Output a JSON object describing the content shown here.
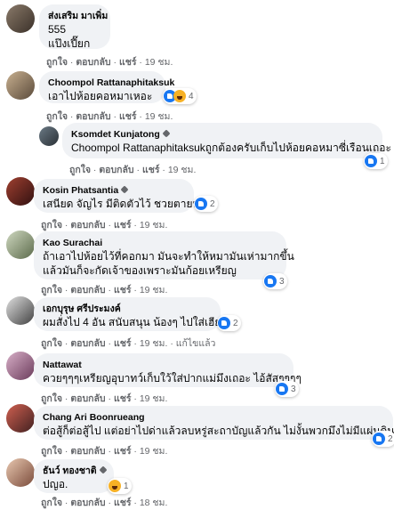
{
  "actions": {
    "like": "ถูกใจ",
    "reply": "ตอบกลับ",
    "share": "แชร์",
    "sep": "·",
    "edited": "แก้ไขแล้ว"
  },
  "comments": [
    {
      "author": "ส่งเสริม มาเพิ่ม",
      "lines": [
        "555",
        "แป๊งเปี๊ยก"
      ],
      "time": "19 ชม."
    },
    {
      "author": "Choompol Rattanaphitaksuk",
      "lines": [
        "เอาไปห้อยคอหมาเหอะ"
      ],
      "reaction": "4",
      "time": "19 ชม."
    },
    {
      "author": "Ksomdet Kunjatong",
      "lines": [
        "Choompol Rattanaphitaksukถูกต้องครับเก็บไปห้อยคอหมาซี่เรือนเถอะ"
      ],
      "reaction": "1",
      "time": "19 ชม."
    },
    {
      "author": "Kosin Phatsantia",
      "lines": [
        "เสนียด จัญไร มีติดตัวไว้ ชวยตายห่า"
      ],
      "reaction": "2",
      "time": "19 ชม."
    },
    {
      "author": "Kao Surachai",
      "lines": [
        "ถ้าเอาไปห้อยไว้ที่คอกมา มันจะทำให้หมามันเห่ามากขึ้น",
        "แล้วมันก็จะกัดเจ้าของเพราะมันก้อยเหรียญ"
      ],
      "reaction": "3",
      "time": "19 ชม."
    },
    {
      "author": "เอกบุรุษ ศรีประมงค์",
      "lines": [
        "ผมสั่งไป 4 อัน สนับสนุน น้องๆ ไปใส่เฮีย"
      ],
      "reaction": "2",
      "time": "19 ชม."
    },
    {
      "author": "Nattawat",
      "lines": [
        "ควยๆๆๆเหรียญอุบาทว์เก็บใว้ใส่ปากแม่มึงเถอะ ไอ้สัสๆๆๆๆ"
      ],
      "reaction": "3",
      "time": "19 ชม."
    },
    {
      "author": "Chang Ari Boonrueang",
      "lines": [
        "ต่อสู้ก็ต่อสู้ไป แต่อย่าไปด่าแล้วลบหรู่สะถาบัญแล้วกัน ไม่งั้นพวกมึงไม่มีแผ่นดินอยู่"
      ],
      "reaction": "2",
      "time": "19 ชม."
    },
    {
      "author": "ธันว์ ทองชาติ",
      "lines": [
        "ปญอ."
      ],
      "reaction": "1",
      "time": "18 ชม."
    }
  ],
  "colors": {
    "bubble": "#f0f2f5",
    "meta": "#65676b",
    "like": "#1877f2",
    "haha": "#f7b125"
  }
}
